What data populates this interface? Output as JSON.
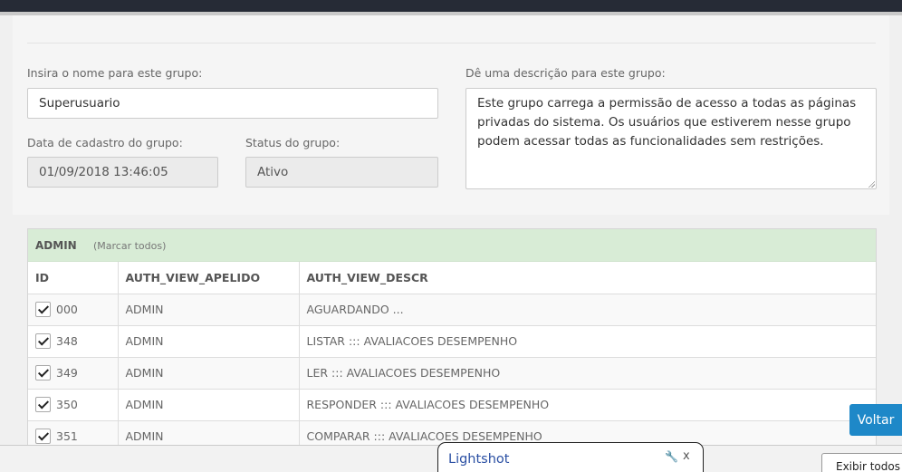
{
  "form": {
    "name_label": "Insira o nome para este grupo:",
    "name_value": "Superusuario",
    "date_label": "Data de cadastro do grupo:",
    "date_value": "01/09/2018 13:46:05",
    "status_label": "Status do grupo:",
    "status_value": "Ativo",
    "description_label": "Dê uma descrição para este grupo:",
    "description_value": "Este grupo carrega a permissão de acesso a todas as páginas privadas do sistema. Os usuários que estiverem nesse grupo podem acessar todas as funcionalidades sem restrições."
  },
  "permissions": {
    "group_title": "ADMIN",
    "mark_all_label": "(Marcar todos)",
    "columns": [
      "ID",
      "AUTH_VIEW_APELIDO",
      "AUTH_VIEW_DESCR"
    ],
    "rows": [
      {
        "id": "000",
        "apelido": "ADMIN",
        "descr": "AGUARDANDO ...",
        "checked": true
      },
      {
        "id": "348",
        "apelido": "ADMIN",
        "descr": "LISTAR ::: AVALIACOES DESEMPENHO",
        "checked": true
      },
      {
        "id": "349",
        "apelido": "ADMIN",
        "descr": "LER ::: AVALIACOES DESEMPENHO",
        "checked": true
      },
      {
        "id": "350",
        "apelido": "ADMIN",
        "descr": "RESPONDER ::: AVALIACOES DESEMPENHO",
        "checked": true
      },
      {
        "id": "351",
        "apelido": "ADMIN",
        "descr": "COMPARAR ::: AVALIACOES DESEMPENHO",
        "checked": true
      }
    ]
  },
  "actions": {
    "back_label": "Voltar"
  },
  "download_bar": {
    "popup_title": "Lightshot",
    "wrench_icon": "wrench-icon",
    "close_glyph": "x",
    "show_all_label": "Exibir todos"
  },
  "colors": {
    "accent": "#1e88c8",
    "panel_header": "#d8ecd6",
    "topbar": "#262b36"
  }
}
